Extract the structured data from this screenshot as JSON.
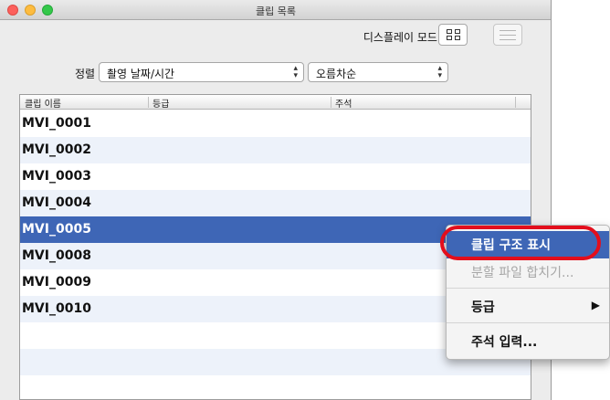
{
  "window": {
    "title": "클립 목록"
  },
  "toolbar": {
    "display_mode_label": "디스플레이 모드:"
  },
  "sort": {
    "label": "정렬",
    "by_value": "촬영 날짜/시간",
    "order_value": "오름차순"
  },
  "table": {
    "columns": [
      "클립 이름",
      "등급",
      "주석"
    ],
    "rows": [
      {
        "name": "MVI_0001"
      },
      {
        "name": "MVI_0002"
      },
      {
        "name": "MVI_0003"
      },
      {
        "name": "MVI_0004"
      },
      {
        "name": "MVI_0005",
        "selected": true
      },
      {
        "name": "MVI_0008"
      },
      {
        "name": "MVI_0009"
      },
      {
        "name": "MVI_0010"
      }
    ]
  },
  "context_menu": {
    "items": [
      {
        "label": "클립 구조 표시",
        "highlighted": true
      },
      {
        "label": "분할 파일 합치기...",
        "disabled": true
      },
      {
        "label": "등급",
        "has_submenu": true
      },
      {
        "label": "주석 입력..."
      }
    ]
  },
  "colors": {
    "selection": "#3e66b6",
    "callout": "#e30e1c",
    "row_alt": "#edf2fa"
  },
  "icons": {
    "grid_mode": "grid-icon",
    "list_mode": "list-icon",
    "select_arrows": "updown-arrows-icon",
    "submenu": "chevron-right-icon"
  }
}
